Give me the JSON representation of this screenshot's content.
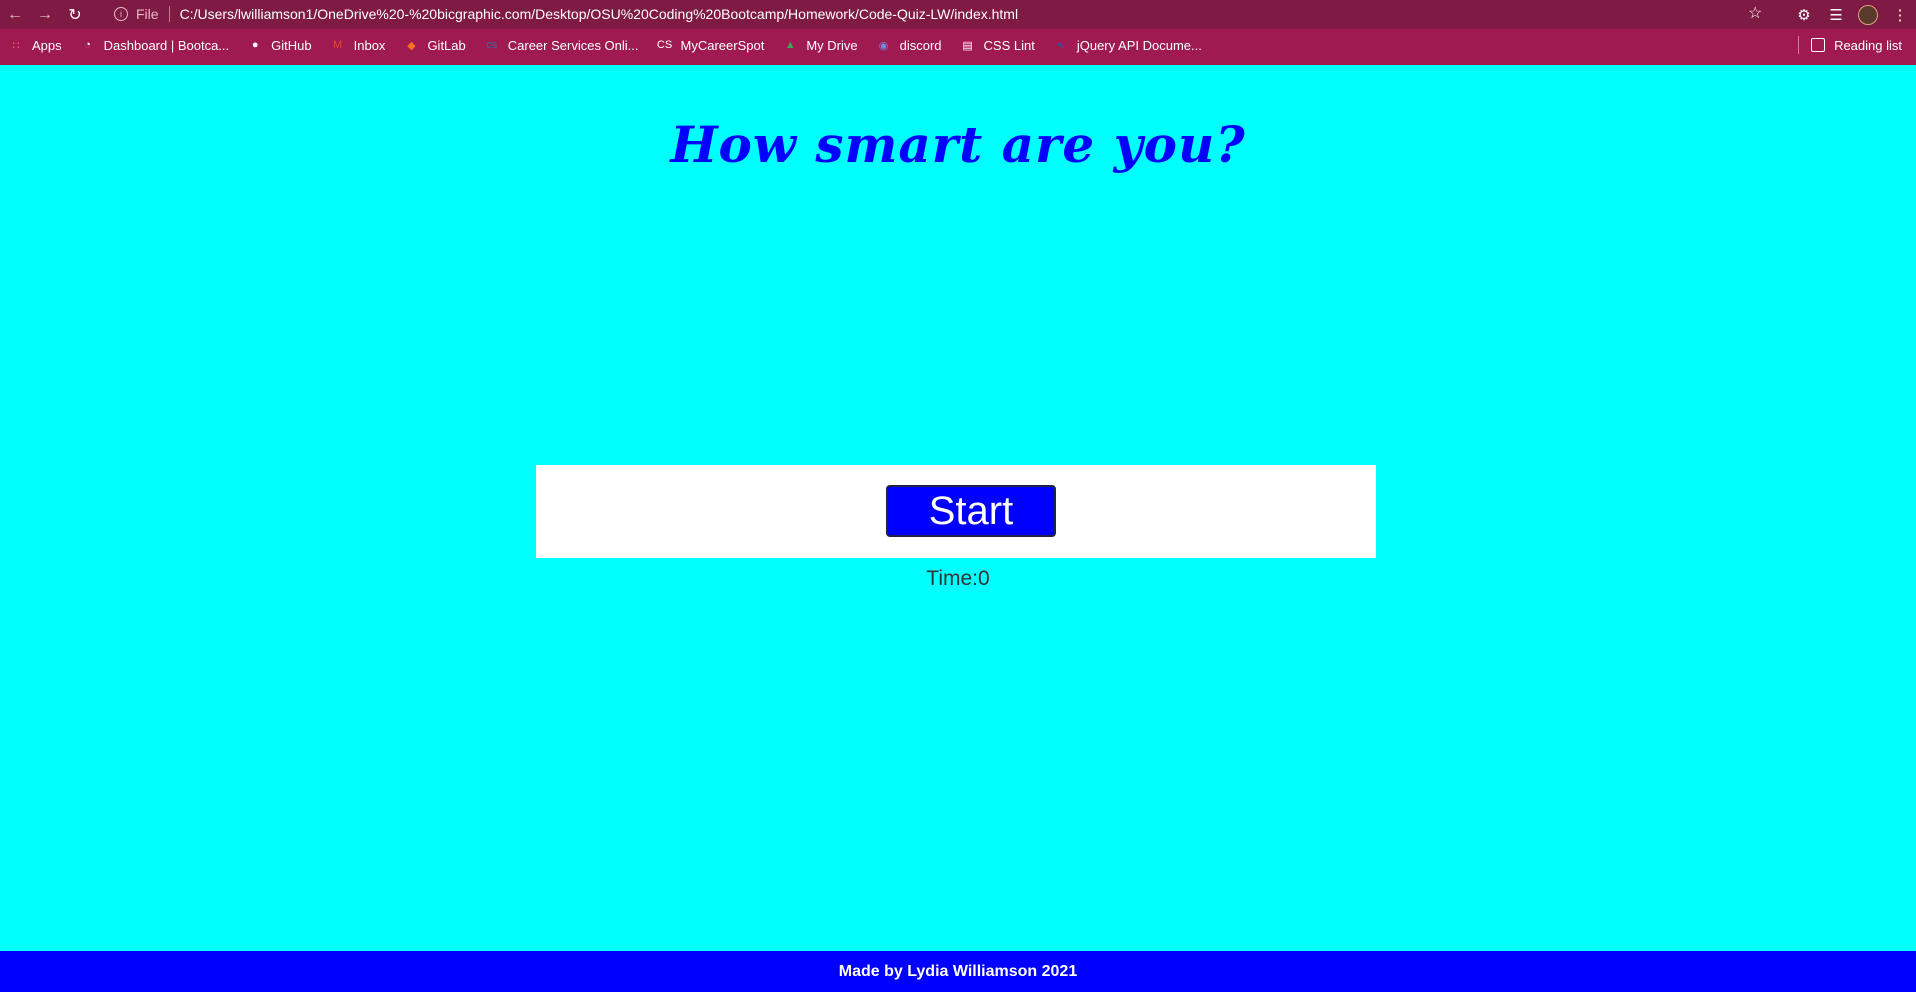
{
  "browser": {
    "url_prefix": "File",
    "url": "C:/Users/lwilliamson1/OneDrive%20-%20bicgraphic.com/Desktop/OSU%20Coding%20Bootcamp/Homework/Code-Quiz-LW/index.html",
    "bookmarks": [
      {
        "label": "Apps",
        "icon": "apps-grid-icon",
        "color": "#ff6b6b"
      },
      {
        "label": "Dashboard | Bootca...",
        "icon": "dashboard-icon",
        "color": "#ffffff"
      },
      {
        "label": "GitHub",
        "icon": "github-icon",
        "color": "#ffffff"
      },
      {
        "label": "Inbox",
        "icon": "gmail-icon",
        "color": "#ea4335"
      },
      {
        "label": "GitLab",
        "icon": "gitlab-icon",
        "color": "#fc6d26"
      },
      {
        "label": "Career Services Onli...",
        "icon": "career-services-icon",
        "color": "#2e6ca4"
      },
      {
        "label": "MyCareerSpot",
        "icon": "mycareerspot-icon",
        "color": "#ffffff"
      },
      {
        "label": "My Drive",
        "icon": "google-drive-icon",
        "color": "#34a853"
      },
      {
        "label": "discord",
        "icon": "discord-icon",
        "color": "#7289da"
      },
      {
        "label": "CSS Lint",
        "icon": "csslint-icon",
        "color": "#ffffff"
      },
      {
        "label": "jQuery API Docume...",
        "icon": "jquery-icon",
        "color": "#0769ad"
      }
    ],
    "reading_list": "Reading list"
  },
  "page": {
    "title": "How smart are you?",
    "start_label": "Start",
    "timer_text": "Time:0",
    "footer": "Made by Lydia Williamson 2021"
  },
  "colors": {
    "background": "#00ffff",
    "accent": "#0000ff",
    "chrome": "#a01a52"
  }
}
